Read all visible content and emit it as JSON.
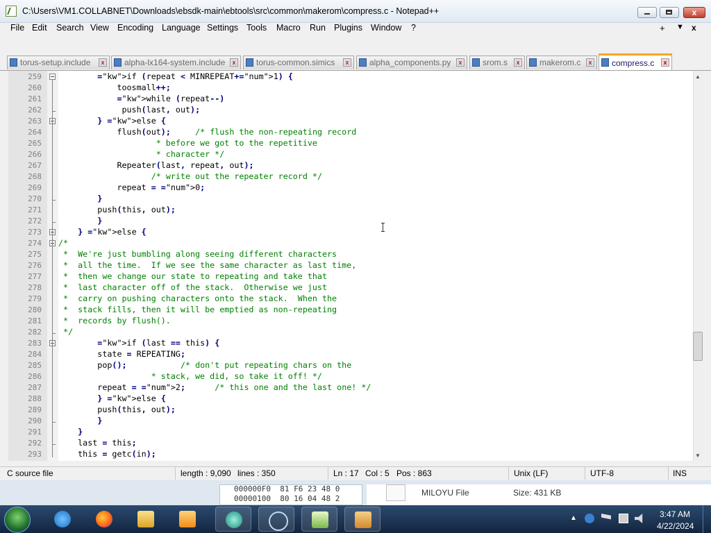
{
  "window": {
    "title": "C:\\Users\\VM1.COLLABNET\\Downloads\\ebsdk-main\\ebtools\\src\\common\\makerom\\compress.c - Notepad++",
    "close_glyph": "x"
  },
  "menu": {
    "items": [
      "File",
      "Edit",
      "Search",
      "View",
      "Encoding",
      "Language",
      "Settings",
      "Tools",
      "Macro",
      "Run",
      "Plugins",
      "Window",
      "?"
    ],
    "right_plus": "+",
    "right_down": "▼",
    "right_x": "x"
  },
  "tabs": [
    {
      "label": "torus-setup.include",
      "active": false
    },
    {
      "label": "alpha-lx164-system.include",
      "active": false
    },
    {
      "label": "torus-common.simics",
      "active": false
    },
    {
      "label": "alpha_components.py",
      "active": false
    },
    {
      "label": "srom.s",
      "active": false
    },
    {
      "label": "makerom.c",
      "active": false
    },
    {
      "label": "compress.c",
      "active": true
    }
  ],
  "tab_close_glyph": "x",
  "editor": {
    "lines": [
      {
        "n": "259",
        "code": "        if (repeat < MINREPEAT+1) {"
      },
      {
        "n": "260",
        "code": "            toosmall++;"
      },
      {
        "n": "261",
        "code": "            while (repeat--)"
      },
      {
        "n": "262",
        "code": "             push(last, out);"
      },
      {
        "n": "263",
        "code": "        } else {"
      },
      {
        "n": "264",
        "code": "            flush(out);     /* flush the non-repeating record"
      },
      {
        "n": "265",
        "code": "                    * before we got to the repetitive"
      },
      {
        "n": "266",
        "code": "                    * character */"
      },
      {
        "n": "267",
        "code": "            Repeater(last, repeat, out);"
      },
      {
        "n": "268",
        "code": "                   /* write out the repeater record */"
      },
      {
        "n": "269",
        "code": "            repeat = 0;"
      },
      {
        "n": "270",
        "code": "        }"
      },
      {
        "n": "271",
        "code": "        push(this, out);"
      },
      {
        "n": "272",
        "code": "        }"
      },
      {
        "n": "273",
        "code": "    } else {"
      },
      {
        "n": "274",
        "code": "/*"
      },
      {
        "n": "275",
        "code": " *  We're just bumbling along seeing different characters"
      },
      {
        "n": "276",
        "code": " *  all the time.  If we see the same character as last time,"
      },
      {
        "n": "277",
        "code": " *  then we change our state to repeating and take that"
      },
      {
        "n": "278",
        "code": " *  last character off of the stack.  Otherwise we just"
      },
      {
        "n": "279",
        "code": " *  carry on pushing characters onto the stack.  When the"
      },
      {
        "n": "280",
        "code": " *  stack fills, then it will be emptied as non-repeating"
      },
      {
        "n": "281",
        "code": " *  records by flush()."
      },
      {
        "n": "282",
        "code": " */"
      },
      {
        "n": "283",
        "code": "        if (last == this) {"
      },
      {
        "n": "284",
        "code": "        state = REPEATING;"
      },
      {
        "n": "285",
        "code": "        pop();           /* don't put repeating chars on the"
      },
      {
        "n": "286",
        "code": "                   * stack, we did, so take it off! */"
      },
      {
        "n": "287",
        "code": "        repeat = 2;      /* this one and the last one! */"
      },
      {
        "n": "288",
        "code": "        } else {"
      },
      {
        "n": "289",
        "code": "        push(this, out);"
      },
      {
        "n": "290",
        "code": "        }"
      },
      {
        "n": "291",
        "code": "    }"
      },
      {
        "n": "292",
        "code": "    last = this;"
      },
      {
        "n": "293",
        "code": "    this = getc(in);"
      }
    ]
  },
  "status": {
    "file_type": "C source file",
    "length": "length : 9,090",
    "lines": "lines : 350",
    "ln": "Ln : 17",
    "col": "Col : 5",
    "pos": "Pos : 863",
    "eol": "Unix (LF)",
    "encoding": "UTF-8",
    "mode": "INS"
  },
  "background": {
    "hex_row1": "000000F0  81 F6 23 48 0",
    "hex_row2": "00000100  80 16 04 48 2",
    "file_name": "MILOYU File",
    "file_size": "Size: 431 KB"
  },
  "taskbar": {
    "time": "3:47 AM",
    "date": "4/22/2024",
    "tray_up": "▲"
  },
  "colors": {
    "keyword": "#0000ff",
    "comment": "#008000",
    "number": "#ff8000",
    "active_tab_accent": "#f5a623"
  }
}
